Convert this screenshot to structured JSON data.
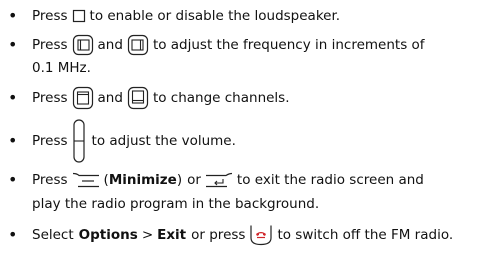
{
  "items": [
    {
      "pre": "Press",
      "icon": "square-key-icon",
      "post": "to enable or disable the loudspeaker."
    },
    {
      "pre": "Press",
      "icon1": "left-nav-key-icon",
      "mid": "and",
      "icon2": "right-nav-key-icon",
      "post": "to adjust the frequency in increments of",
      "cont": "0.1 MHz."
    },
    {
      "pre": "Press",
      "icon1": "up-nav-key-icon",
      "mid": "and",
      "icon2": "down-nav-key-icon",
      "post": "to change channels."
    },
    {
      "pre": "Press",
      "icon": "volume-key-icon",
      "post": "to adjust the volume."
    },
    {
      "pre": "Press",
      "icon1": "left-softkey-icon",
      "paren_open": "(",
      "bold": "Minimize",
      "paren_close": ")",
      "mid": "or",
      "icon2": "back-key-icon",
      "post": "to exit the radio screen and",
      "cont": "play the radio program in the background."
    },
    {
      "pre": "Select",
      "bold1": "Options",
      "sep": ">",
      "bold2": "Exit",
      "mid": "or press",
      "icon": "end-call-key-icon",
      "post": "to switch off the FM radio."
    }
  ],
  "colors": {
    "text": "#111111",
    "end_key": "#d0262b"
  }
}
